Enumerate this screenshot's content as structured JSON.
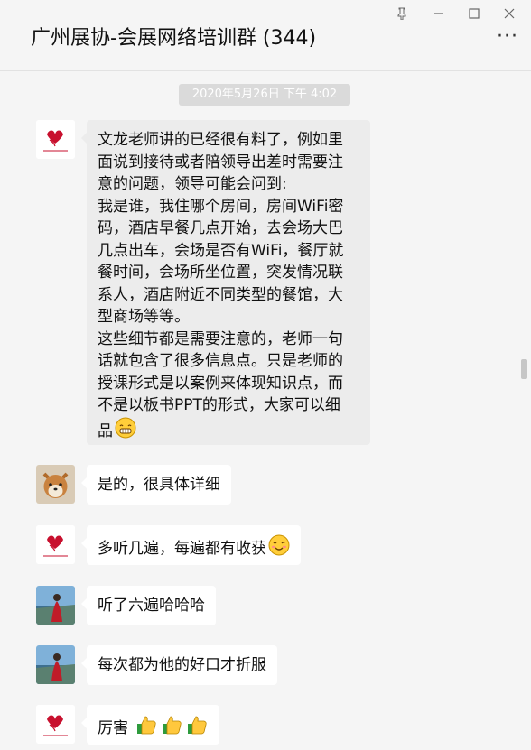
{
  "window": {
    "title": "广州展协-会展网络培训群 (344)",
    "more_label": "···"
  },
  "chat": {
    "timestamp": "2020年5月26日 下午 4:02",
    "messages": [
      {
        "avatar": "logo-avatar",
        "lines": [
          "文龙老师讲的已经很有料了，例如里",
          "面说到接待或者陪领导出差时需要注",
          "意的问题，领导可能会问到:",
          "我是谁，我住哪个房间，房间WiFi密",
          "码，酒店早餐几点开始，去会场大巴",
          "几点出车，会场是否有WiFi，餐厅就",
          "餐时间，会场所坐位置，突发情况联",
          "系人，酒店附近不同类型的餐馆，大",
          "型商场等等。",
          "这些细节都是需要注意的，老师一句",
          "话就包含了很多信息点。只是老师的",
          "授课形式是以案例来体现知识点，而",
          "不是以板书PPT的形式，大家可以细",
          "品"
        ],
        "emoji": "grin-emoji"
      },
      {
        "avatar": "dog-avatar",
        "text": "是的，很具体详细"
      },
      {
        "avatar": "logo-avatar",
        "text": "多听几遍，每遍都有收获",
        "emoji": "smile-emoji"
      },
      {
        "avatar": "person-avatar",
        "text": "听了六遍哈哈哈"
      },
      {
        "avatar": "person-avatar",
        "text": "每次都为他的好口才折服"
      },
      {
        "avatar": "logo-avatar",
        "text": "厉害",
        "emoji": "thumbs-up-emoji"
      }
    ]
  },
  "colors": {
    "background": "#f5f5f5",
    "bubble": "#ffffff",
    "long_bubble": "#ececec",
    "logo_red": "#c8102e"
  }
}
